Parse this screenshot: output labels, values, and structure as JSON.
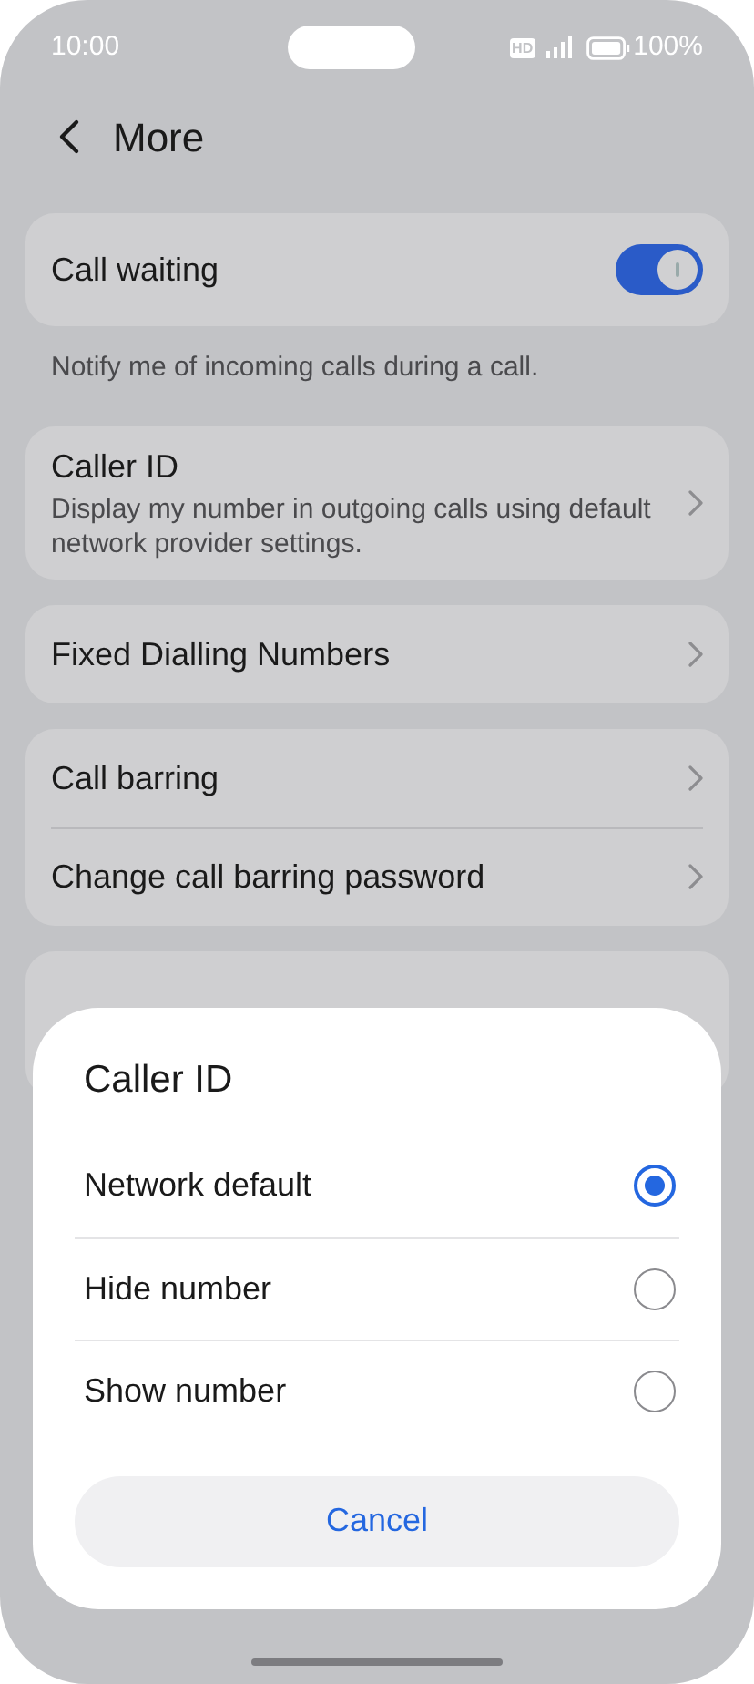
{
  "status_bar": {
    "time": "10:00",
    "hd": "HD",
    "battery": "100%"
  },
  "header": {
    "title": "More"
  },
  "settings": [
    {
      "kind": "toggle",
      "title": "Call waiting",
      "on": true
    },
    {
      "kind": "note",
      "text": "Notify me of incoming calls during a call."
    },
    {
      "kind": "group",
      "items": [
        {
          "title": "Caller ID",
          "subtitle": "Display my number in outgoing calls using default network provider settings."
        }
      ]
    },
    {
      "kind": "group",
      "items": [
        {
          "title": "Fixed Dialling Numbers"
        }
      ]
    },
    {
      "kind": "group",
      "items": [
        {
          "title": "Call barring"
        },
        {
          "title": "Change call barring password"
        }
      ]
    },
    {
      "kind": "covered"
    }
  ],
  "dialog": {
    "title": "Caller ID",
    "options": [
      {
        "label": "Network default",
        "selected": true
      },
      {
        "label": "Hide number",
        "selected": false
      },
      {
        "label": "Show number",
        "selected": false
      }
    ],
    "cancel": "Cancel"
  }
}
